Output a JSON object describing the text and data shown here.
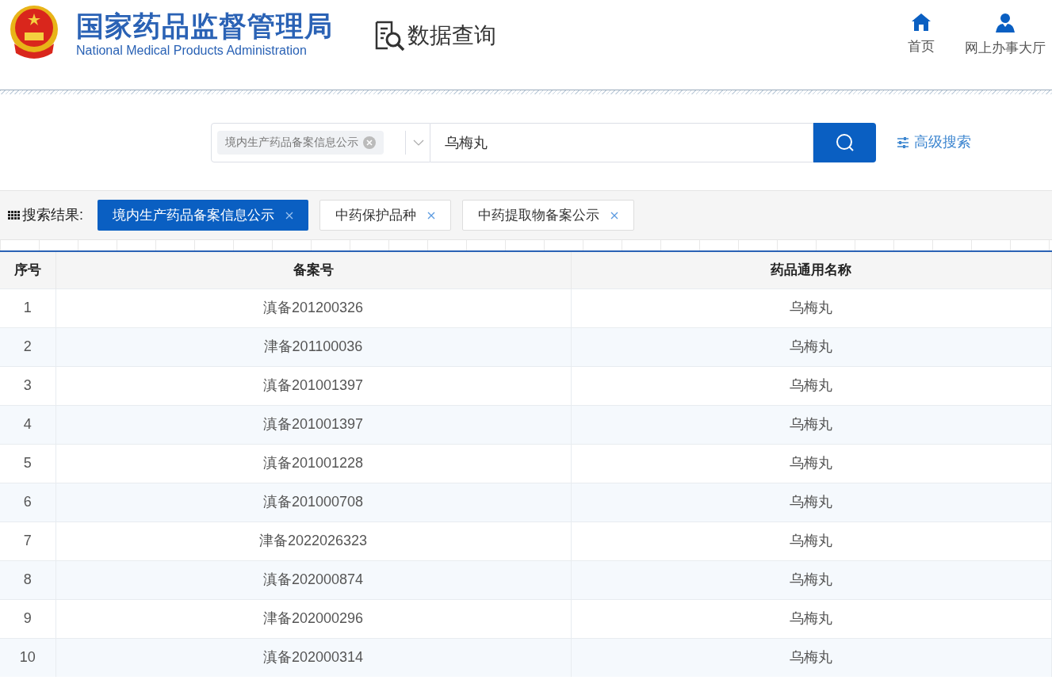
{
  "header": {
    "title": "国家药品监督管理局",
    "subtitle": "National Medical Products Administration",
    "section": "数据查询",
    "nav": [
      {
        "kind": "home",
        "label": "首页"
      },
      {
        "kind": "user",
        "label": "网上办事大厅"
      }
    ]
  },
  "search": {
    "category_tag": "境内生产药品备案信息公示",
    "value": "乌梅丸",
    "advanced": "高级搜索"
  },
  "results": {
    "label": "搜索结果:",
    "tabs": [
      {
        "label": "境内生产药品备案信息公示",
        "selected": true
      },
      {
        "label": "中药保护品种",
        "selected": false
      },
      {
        "label": "中药提取物备案公示",
        "selected": false
      }
    ]
  },
  "table": {
    "columns": [
      "序号",
      "备案号",
      "药品通用名称"
    ],
    "rows": [
      [
        "1",
        "滇备201200326",
        "乌梅丸"
      ],
      [
        "2",
        "津备201100036",
        "乌梅丸"
      ],
      [
        "3",
        "滇备201001397",
        "乌梅丸"
      ],
      [
        "4",
        "滇备201001397",
        "乌梅丸"
      ],
      [
        "5",
        "滇备201001228",
        "乌梅丸"
      ],
      [
        "6",
        "滇备201000708",
        "乌梅丸"
      ],
      [
        "7",
        "津备2022026323",
        "乌梅丸"
      ],
      [
        "8",
        "滇备202000874",
        "乌梅丸"
      ],
      [
        "9",
        "津备202000296",
        "乌梅丸"
      ],
      [
        "10",
        "滇备202000314",
        "乌梅丸"
      ]
    ]
  }
}
